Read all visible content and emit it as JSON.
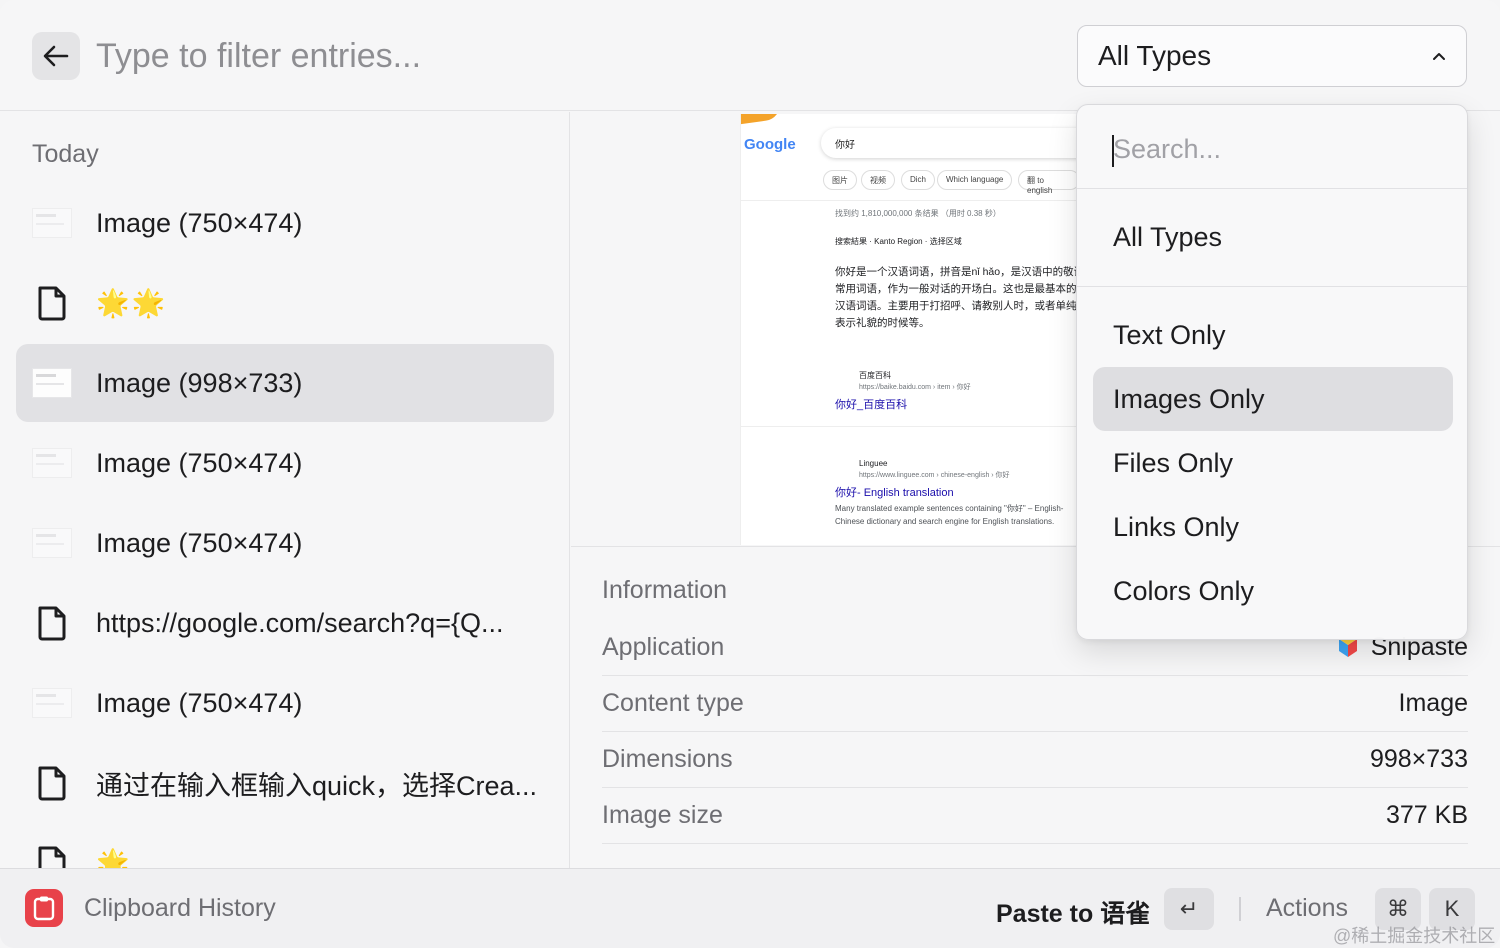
{
  "header": {
    "search_placeholder": "Type to filter entries...",
    "type_filter_value": "All Types"
  },
  "list": {
    "section_title": "Today",
    "items": [
      {
        "kind": "image",
        "label": "Image (750×474)"
      },
      {
        "kind": "file",
        "label": "🌟🌟"
      },
      {
        "kind": "image",
        "label": "Image (998×733)",
        "selected": true
      },
      {
        "kind": "image",
        "label": "Image (750×474)"
      },
      {
        "kind": "image",
        "label": "Image (750×474)"
      },
      {
        "kind": "file",
        "label": "https://google.com/search?q={Q..."
      },
      {
        "kind": "image",
        "label": "Image (750×474)"
      },
      {
        "kind": "file",
        "label": "通过在输入框输入quick，选择Crea..."
      },
      {
        "kind": "file",
        "label": "🌟"
      }
    ]
  },
  "preview": {
    "logo": "Google",
    "query": "你好",
    "chips": [
      "图片",
      "视频",
      "Dich",
      "Which language",
      "翻 to english"
    ],
    "result_count": "找到约 1,810,000,000 条结果 （用时 0.38 秒）",
    "region": "搜索結果 · Kanto Region · 选择区域",
    "snippet": "你好是一个汉语词语，拼音是nǐ hǎo，是汉语中的敬语常用词语，作为一般对话的开场白。这也是最基本的汉语词语。主要用于打招呼、请教别人时，或者单纯表示礼貌的时候等。",
    "result1_source": "百度百科",
    "result1_url": "https://baike.baidu.com › item › 你好",
    "result1_title": "你好_百度百科",
    "result2_source": "Linguee",
    "result2_url": "https://www.linguee.com › chinese-english › 你好",
    "result2_title": "你好- English translation",
    "result2_desc": "Many translated example sentences containing \"你好\" – English-Chinese dictionary and search engine for English translations."
  },
  "info": {
    "title": "Information",
    "rows": [
      {
        "key": "Application",
        "value": "Snipaste"
      },
      {
        "key": "Content type",
        "value": "Image"
      },
      {
        "key": "Dimensions",
        "value": "998×733"
      },
      {
        "key": "Image size",
        "value": "377 KB"
      }
    ]
  },
  "dropdown": {
    "search_placeholder": "Search...",
    "options": [
      "All Types",
      "Text Only",
      "Images Only",
      "Files Only",
      "Links Only",
      "Colors Only"
    ],
    "active_option": "Images Only"
  },
  "footer": {
    "title": "Clipboard History",
    "primary_action": "Paste to 语雀",
    "enter_key": "↵",
    "actions_label": "Actions",
    "cmd_key": "⌘",
    "k_key": "K"
  },
  "watermark": "@稀土掘金技术社区",
  "colors": {
    "accent": "#e8424a",
    "selection": "#e1e1e4",
    "link": "#1a0dab"
  }
}
